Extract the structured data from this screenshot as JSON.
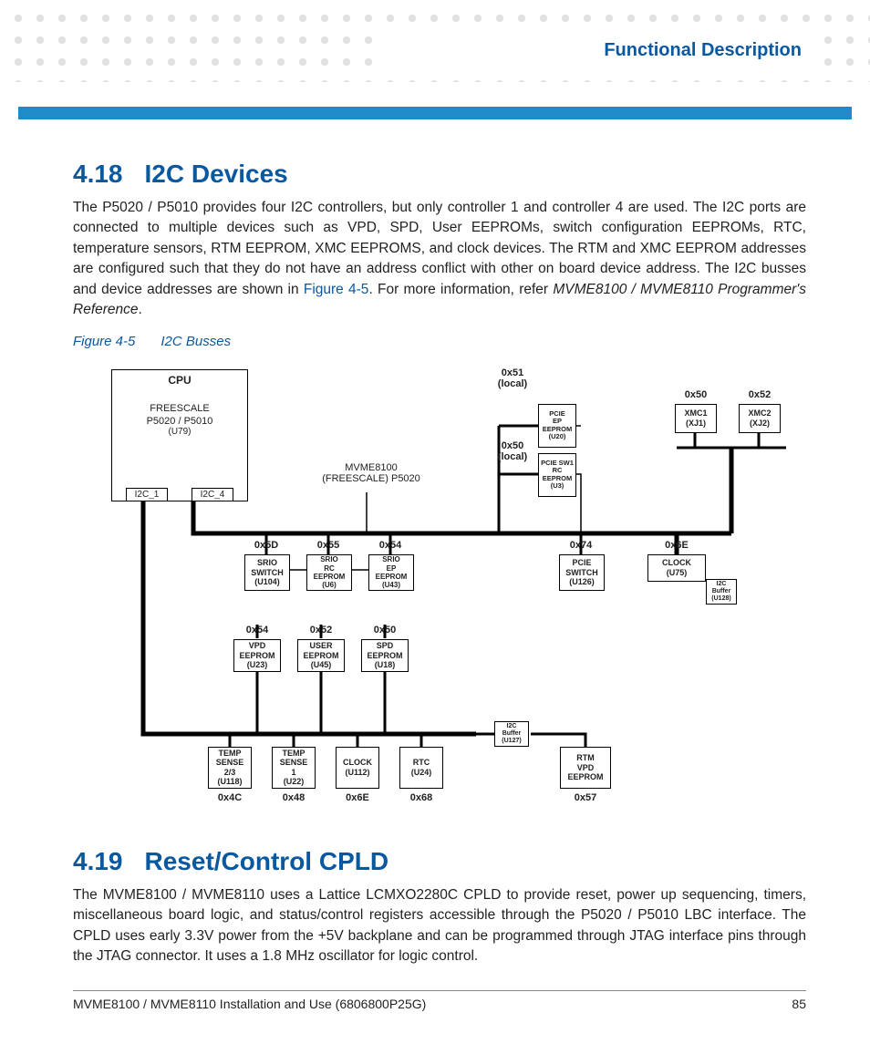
{
  "header": {
    "title": "Functional Description"
  },
  "section418": {
    "num": "4.18",
    "title": "I2C Devices",
    "para_a": "The P5020 / P5010 provides four I2C controllers, but only controller 1 and controller 4 are used. The I2C ports are connected to multiple devices such as VPD, SPD, User EEPROMs, switch configuration EEPROMs, RTC, temperature sensors, RTM EEPROM, XMC EEPROMS, and clock devices. The RTM and XMC EEPROM addresses are configured such that they do not have an address conflict with other on board device address. The I2C busses and device addresses are shown in ",
    "figref": "Figure 4-5",
    "para_b": ". For more information, refer ",
    "docref": "MVME8100 / MVME8110 Programmer's Reference",
    "para_c": "."
  },
  "figure": {
    "num": "Figure 4-5",
    "title": "I2C Busses"
  },
  "diagram": {
    "cpu": {
      "title": "CPU",
      "sub1": "FREESCALE",
      "sub2": "P5020 / P5010",
      "sub3": "(U79)",
      "port1": "I2C_1",
      "port2": "I2C_4"
    },
    "center_label1": "MVME8100",
    "center_label2": "(FREESCALE) P5020",
    "pcie_ep_addr": "0x51",
    "pcie_ep_local": "(local)",
    "pcie_ep": "PCIE\nEP\nEEPROM\n(U20)",
    "pcie_sw_addr": "0x50",
    "pcie_sw_local": "(local)",
    "pcie_sw_rc": "PCIE SW1\nRC\nEEPROM\n(U3)",
    "xmc1_addr": "0x50",
    "xmc1": "XMC1\n(XJ1)",
    "xmc2_addr": "0x52",
    "xmc2": "XMC2\n(XJ2)",
    "srio_sw_addr": "0x5D",
    "srio_sw": "SRIO\nSWITCH\n(U104)",
    "srio_rc_addr": "0x55",
    "srio_rc": "SRIO\nRC\nEEPROM\n(U6)",
    "srio_ep_addr": "0x54",
    "srio_ep": "SRIO\nEP\nEEPROM\n(U43)",
    "pcie_switch_addr": "0x74",
    "pcie_switch": "PCIE\nSWITCH\n(U126)",
    "clock_addr": "0x6E",
    "clock": "CLOCK\n(U75)",
    "i2c_buffer128": "I2C\nBuffer\n(U128)",
    "vpd_addr": "0x54",
    "vpd": "VPD\nEEPROM\n(U23)",
    "user_addr": "0x52",
    "user": "USER\nEEPROM\n(U45)",
    "spd_addr": "0x50",
    "spd": "SPD\nEEPROM\n(U18)",
    "temp23_addr": "0x4C",
    "temp23": "TEMP\nSENSE\n2/3\n(U118)",
    "temp1_addr": "0x48",
    "temp1": "TEMP\nSENSE\n1\n(U22)",
    "clock112_addr": "0x6E",
    "clock112": "CLOCK\n(U112)",
    "rtc_addr": "0x68",
    "rtc": "RTC\n(U24)",
    "i2c_buffer127": "I2C\nBuffer\n(U127)",
    "rtm_addr": "0x57",
    "rtm": "RTM\nVPD\nEEPROM"
  },
  "section419": {
    "num": "4.19",
    "title": "Reset/Control CPLD",
    "para": "The MVME8100 / MVME8110 uses a Lattice LCMXO2280C CPLD to provide reset, power up sequencing, timers, miscellaneous board logic, and status/control registers accessible through the P5020 / P5010 LBC interface. The CPLD uses early 3.3V power from the +5V backplane and can be programmed through JTAG interface pins through the JTAG connector. It uses a 1.8 MHz oscillator for logic control."
  },
  "footer": {
    "left": "MVME8100 / MVME8110 Installation and Use (6806800P25G)",
    "right": "85"
  }
}
